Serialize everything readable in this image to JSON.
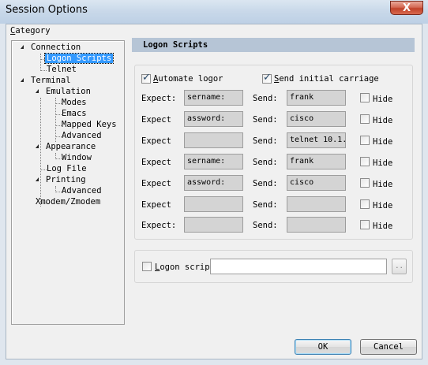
{
  "window": {
    "title": "Session Options",
    "close_glyph": "X"
  },
  "category": {
    "label": "Category",
    "tree": [
      {
        "label": "Connection"
      },
      {
        "label": "Logon Scripts",
        "selected": true
      },
      {
        "label": "Telnet"
      },
      {
        "label": "Terminal"
      },
      {
        "label": "Emulation"
      },
      {
        "label": "Modes"
      },
      {
        "label": "Emacs"
      },
      {
        "label": "Mapped Keys"
      },
      {
        "label": "Advanced"
      },
      {
        "label": "Appearance"
      },
      {
        "label": "Window"
      },
      {
        "label": "Log File"
      },
      {
        "label": "Printing"
      },
      {
        "label": "Advanced"
      },
      {
        "label": "Xmodem/Zmodem"
      }
    ]
  },
  "section": {
    "title": "Logon Scripts"
  },
  "options": {
    "automate_logon": {
      "label": "Automate logor",
      "checked": true
    },
    "send_initial_carriage": {
      "label": "Send initial carriage",
      "checked": true
    }
  },
  "rows": [
    {
      "expect_label": "Expect:",
      "expect": "sername:",
      "send_label": "Send:",
      "send": "frank",
      "hide_label": "Hide"
    },
    {
      "expect_label": "Expect",
      "expect": "assword:",
      "send_label": "Send:",
      "send": "cisco",
      "hide_label": "Hide"
    },
    {
      "expect_label": "Expect",
      "expect": "",
      "send_label": "Send:",
      "send": "telnet 10.1.",
      "hide_label": "Hide"
    },
    {
      "expect_label": "Expect",
      "expect": "sername:",
      "send_label": "Send:",
      "send": "frank",
      "hide_label": "Hide"
    },
    {
      "expect_label": "Expect",
      "expect": "assword:",
      "send_label": "Send:",
      "send": "cisco",
      "hide_label": "Hide"
    },
    {
      "expect_label": "Expect",
      "expect": "",
      "send_label": "Send:",
      "send": "",
      "hide_label": "Hide"
    },
    {
      "expect_label": "Expect:",
      "expect": "",
      "send_label": "Send:",
      "send": "",
      "hide_label": "Hide"
    }
  ],
  "logon_script": {
    "label": "Logon scrip",
    "value": "",
    "browse_label": ".."
  },
  "buttons": {
    "ok": "OK",
    "cancel": "Cancel"
  }
}
